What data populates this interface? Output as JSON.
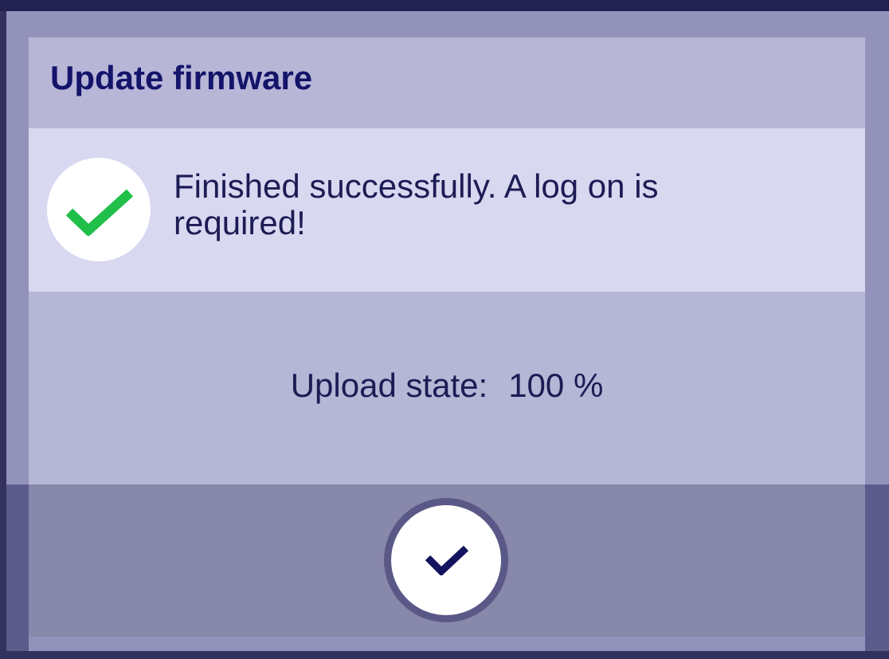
{
  "dialog": {
    "title": "Update firmware",
    "message": "Finished successfully. A log on is required!",
    "upload_label": "Upload state:",
    "upload_value": "100 %"
  },
  "icons": {
    "status": "checkmark-success-icon",
    "confirm": "checkmark-confirm-icon"
  },
  "colors": {
    "title": "#14146a",
    "success_check": "#1fbf4a",
    "confirm_check": "#14145e",
    "message_band": "#d9d8f1",
    "footer": "#8888ab"
  }
}
